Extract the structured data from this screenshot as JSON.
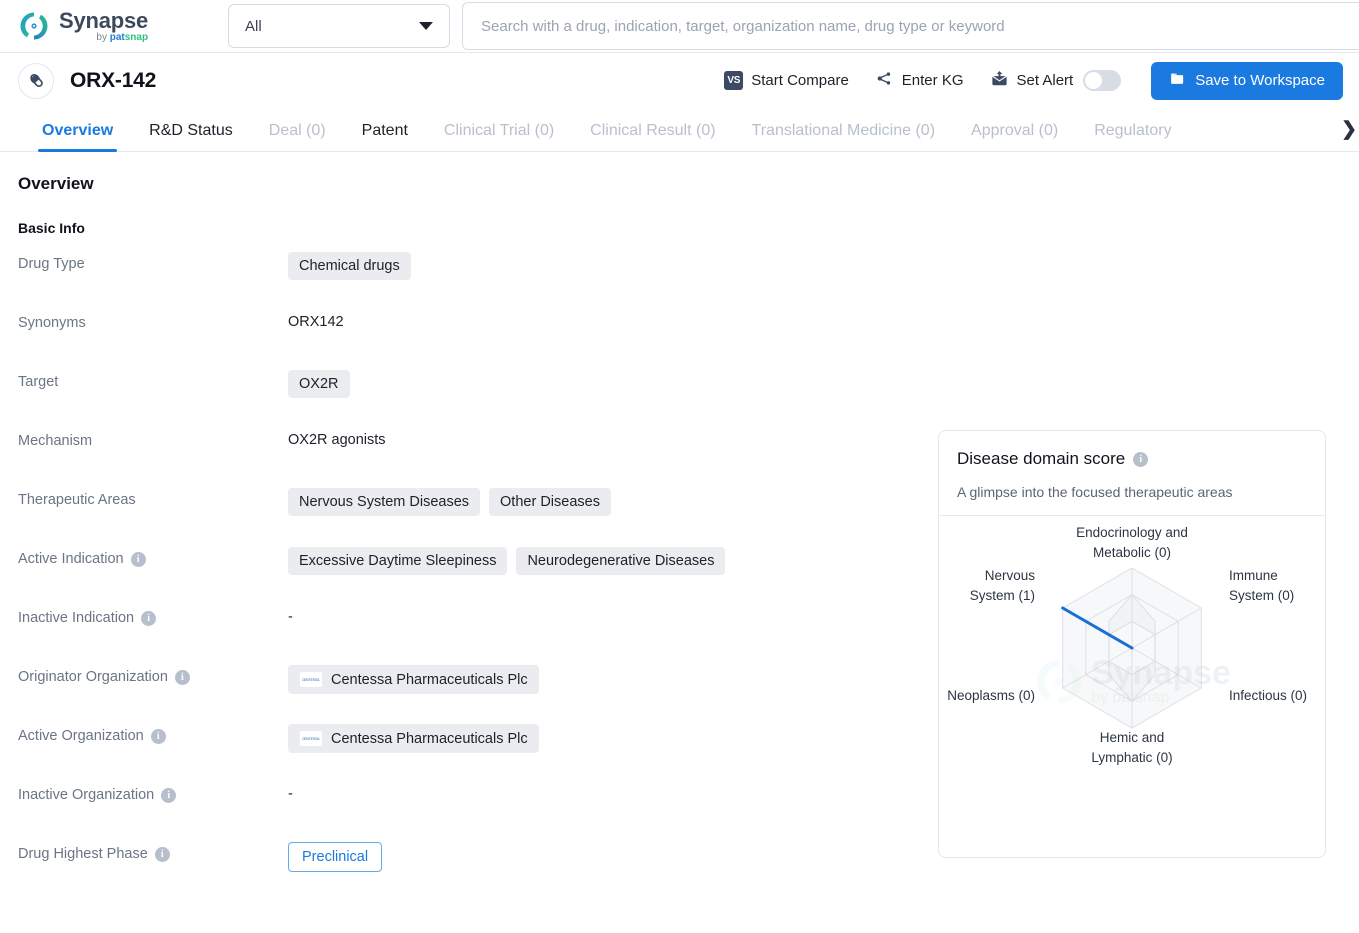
{
  "brand": {
    "name": "Synapse",
    "by_prefix": "by ",
    "by_pat": "pat",
    "by_snap": "snap",
    "accent": "#1a7ae0"
  },
  "topbar": {
    "category_select": {
      "value": "All",
      "icon": "chevron-down-icon"
    },
    "search": {
      "value": "",
      "placeholder": "Search with a drug, indication, target, organization name, drug type or keyword"
    }
  },
  "drug_header": {
    "icon": "capsule-icon",
    "title": "ORX-142",
    "actions": [
      {
        "label": "Start Compare",
        "icon": "vs-icon"
      },
      {
        "label": "Enter KG",
        "icon": "knowledge-graph-icon"
      },
      {
        "label": "Set Alert",
        "icon": "alert-mail-icon",
        "toggle": false
      }
    ],
    "save_button": {
      "label": "Save to Workspace",
      "icon": "folder-icon"
    }
  },
  "tabs": [
    {
      "label": "Overview",
      "state": "active"
    },
    {
      "label": "R&D Status",
      "state": "dark"
    },
    {
      "label": "Deal (0)",
      "state": "muted"
    },
    {
      "label": "Patent",
      "state": "dark"
    },
    {
      "label": "Clinical Trial (0)",
      "state": "muted"
    },
    {
      "label": "Clinical Result (0)",
      "state": "muted"
    },
    {
      "label": "Translational Medicine (0)",
      "state": "muted"
    },
    {
      "label": "Approval (0)",
      "state": "muted"
    },
    {
      "label": "Regulatory",
      "state": "muted"
    }
  ],
  "tabs_next_icon": "chevron-right-icon",
  "overview": {
    "heading": "Overview",
    "basic_info_heading": "Basic Info",
    "rows": [
      {
        "label": "Drug Type",
        "info": false,
        "kind": "chips",
        "values": [
          "Chemical drugs"
        ]
      },
      {
        "label": "Synonyms",
        "info": false,
        "kind": "text",
        "values": [
          "ORX142"
        ]
      },
      {
        "label": "Target",
        "info": false,
        "kind": "chips",
        "values": [
          "OX2R"
        ]
      },
      {
        "label": "Mechanism",
        "info": false,
        "kind": "text",
        "values": [
          "OX2R agonists"
        ]
      },
      {
        "label": "Therapeutic Areas",
        "info": false,
        "kind": "chips",
        "values": [
          "Nervous System Diseases",
          "Other Diseases"
        ]
      },
      {
        "label": "Active Indication",
        "info": true,
        "kind": "chips",
        "values": [
          "Excessive Daytime Sleepiness",
          "Neurodegenerative Diseases"
        ]
      },
      {
        "label": "Inactive Indication",
        "info": true,
        "kind": "dash",
        "values": [
          "-"
        ]
      },
      {
        "label": "Originator Organization",
        "info": true,
        "kind": "org",
        "values": [
          "Centessa Pharmaceuticals Plc"
        ]
      },
      {
        "label": "Active Organization",
        "info": true,
        "kind": "org",
        "values": [
          "Centessa Pharmaceuticals Plc"
        ]
      },
      {
        "label": "Inactive Organization",
        "info": true,
        "kind": "dash",
        "values": [
          "-"
        ]
      },
      {
        "label": "Drug Highest Phase",
        "info": true,
        "kind": "phase",
        "values": [
          "Preclinical"
        ]
      }
    ]
  },
  "radar_panel": {
    "title": "Disease domain score",
    "title_info_icon": "info-icon",
    "description": "A glimpse into the focused therapeutic areas",
    "watermark": {
      "text": "Synapse",
      "sub_by": "by ",
      "sub_pat": "pat",
      "sub_snap": "snap"
    }
  },
  "chart_data": {
    "type": "radar",
    "title": "Disease domain score",
    "subtitle": "A glimpse into the focused therapeutic areas",
    "categories": [
      "Endocrinology and Metabolic (0)",
      "Immune System (0)",
      "Infectious (0)",
      "Hemic and Lymphatic (0)",
      "Neoplasms (0)",
      "Nervous System (1)"
    ],
    "category_names": [
      "Endocrinology and Metabolic",
      "Immune System",
      "Infectious",
      "Hemic and Lymphatic",
      "Neoplasms",
      "Nervous System"
    ],
    "values": [
      0,
      0,
      0,
      0,
      0,
      1
    ],
    "max": 1,
    "rings": 3,
    "series": [
      {
        "name": "Disease domain score",
        "values": [
          0,
          0,
          0,
          0,
          0,
          1
        ],
        "color": "#1a6fd4"
      }
    ],
    "grid": true,
    "legend": "none",
    "axis_color": "#dcdfe4"
  }
}
